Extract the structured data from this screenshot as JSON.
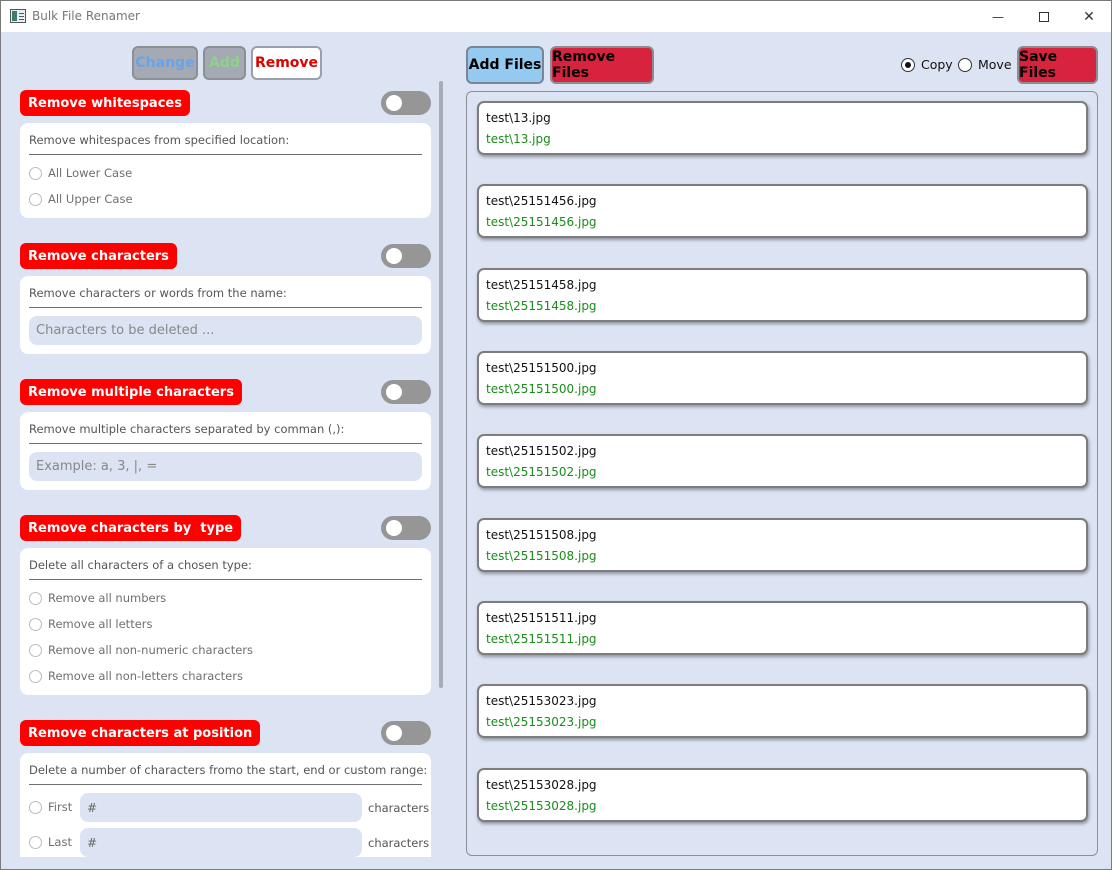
{
  "window": {
    "title": "Bulk File Renamer"
  },
  "window_controls": {
    "minimize": "—",
    "maximize": "☐",
    "close": "✕"
  },
  "mode_buttons": {
    "change": "Change",
    "add": "Add",
    "remove": "Remove"
  },
  "sections": {
    "whitespace": {
      "title": "Remove whitespaces",
      "desc": "Remove whitespaces from specified location:",
      "options": [
        "All Lower Case",
        "All Upper Case"
      ]
    },
    "characters": {
      "title": "Remove characters",
      "desc": "Remove characters or words from the name:",
      "placeholder": "Characters to be deleted ..."
    },
    "multiple": {
      "title": "Remove multiple characters",
      "desc": "Remove multiple characters separated by comman (,):",
      "placeholder": "Example: a, 3, |, ="
    },
    "by_type": {
      "title": "Remove characters by  type",
      "desc": "Delete all characters of a chosen type:",
      "options": [
        "Remove all numbers",
        "Remove all letters",
        "Remove all non-numeric characters",
        "Remove all non-letters characters"
      ]
    },
    "at_position": {
      "title": "Remove characters at position",
      "desc": "Delete a number of characters fromo the start, end or custom range:",
      "rows": [
        {
          "label": "First",
          "placeholder": "#",
          "unit": "characters"
        },
        {
          "label": "Last",
          "placeholder": "#",
          "unit": "characters"
        }
      ]
    }
  },
  "right_toolbar": {
    "add_files": "Add Files",
    "remove_files": "Remove Files",
    "copy": "Copy",
    "move": "Move",
    "selected": "copy",
    "save_files": "Save Files"
  },
  "files": [
    {
      "old": "test\\13.jpg",
      "new": "test\\13.jpg"
    },
    {
      "old": "test\\25151456.jpg",
      "new": "test\\25151456.jpg"
    },
    {
      "old": "test\\25151458.jpg",
      "new": "test\\25151458.jpg"
    },
    {
      "old": "test\\25151500.jpg",
      "new": "test\\25151500.jpg"
    },
    {
      "old": "test\\25151502.jpg",
      "new": "test\\25151502.jpg"
    },
    {
      "old": "test\\25151508.jpg",
      "new": "test\\25151508.jpg"
    },
    {
      "old": "test\\25151511.jpg",
      "new": "test\\25151511.jpg"
    },
    {
      "old": "test\\25153023.jpg",
      "new": "test\\25153023.jpg"
    },
    {
      "old": "test\\25153028.jpg",
      "new": "test\\25153028.jpg"
    }
  ],
  "colors": {
    "accent_red": "#ff0000",
    "button_red": "#d8233f",
    "button_blue": "#94c9f0",
    "new_name_green": "#1a8c1a",
    "background": "#dce3f3"
  }
}
